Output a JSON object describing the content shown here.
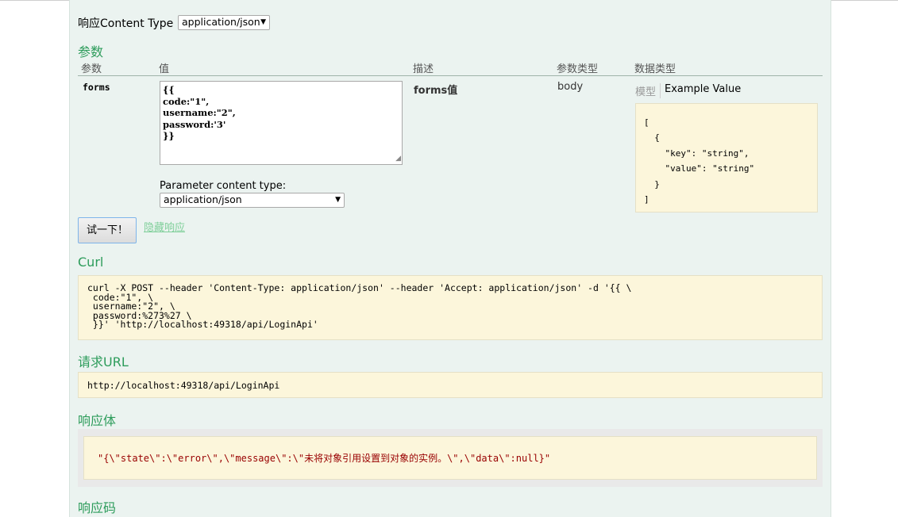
{
  "response_content_type": {
    "label": "响应Content Type",
    "selected": "application/json"
  },
  "params": {
    "title": "参数",
    "headers": {
      "param": "参数",
      "value": "值",
      "desc": "描述",
      "ptype": "参数类型",
      "dtype": "数据类型"
    },
    "row": {
      "name": "forms",
      "value_lines": [
        "{{",
        "code:\"1\",",
        "username:\"2\",",
        "password:'3'",
        "}}"
      ],
      "desc": "forms值",
      "ptype": "body",
      "model_tab": "模型",
      "example_tab": "Example Value",
      "example_lines": [
        "[",
        "  {",
        "    \"key\": \"string\",",
        "    \"value\": \"string\"",
        "  }",
        "]"
      ],
      "content_type_label": "Parameter content type:",
      "content_type_selected": "application/json"
    }
  },
  "actions": {
    "try_button": "试一下！",
    "hide_response": "隐藏响应"
  },
  "curl": {
    "title": "Curl",
    "lines": [
      "curl -X POST --header 'Content-Type: application/json' --header 'Accept: application/json' -d '{{ \\",
      " code:\"1\", \\",
      " username:\"2\", \\",
      " password:%273%27 \\",
      " }}' 'http://localhost:49318/api/LoginApi'"
    ]
  },
  "request_url": {
    "title": "请求URL",
    "value": "http://localhost:49318/api/LoginApi"
  },
  "response_body": {
    "title": "响应体",
    "value": "\"{\\\"state\\\":\\\"error\\\",\\\"message\\\":\\\"未将对象引用设置到对象的实例。\\\",\\\"data\\\":null}\""
  },
  "response_code": {
    "title": "响应码"
  }
}
